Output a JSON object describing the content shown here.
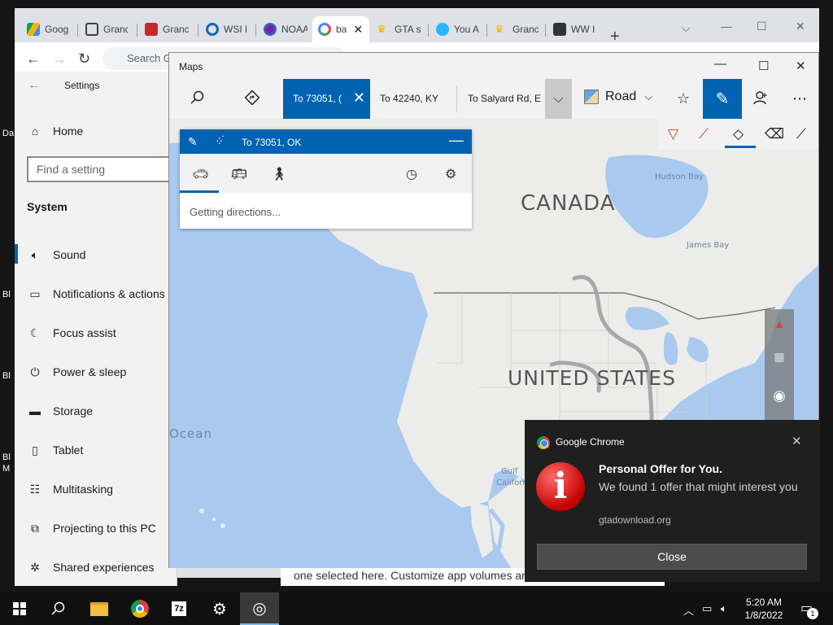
{
  "desktop": {
    "fragments": [
      "Da",
      "Bl",
      "Bl",
      "Bl",
      "M"
    ]
  },
  "chrome": {
    "tabs": [
      {
        "label": "Goog",
        "icon": "google-drive-icon"
      },
      {
        "label": "Granc",
        "icon": "page-icon"
      },
      {
        "label": "Granc",
        "icon": "rockstar-icon"
      },
      {
        "label": "WSI L",
        "icon": "wsi-icon"
      },
      {
        "label": "NOAA",
        "icon": "noaa-icon"
      },
      {
        "label": "ba",
        "icon": "google-icon",
        "active": true
      },
      {
        "label": "GTA s",
        "icon": "crown-icon"
      },
      {
        "label": "You A",
        "icon": "you-icon"
      },
      {
        "label": "Granc",
        "icon": "crown-icon"
      },
      {
        "label": "WW I",
        "icon": "ww-icon"
      }
    ],
    "omnibox_placeholder": "Search G"
  },
  "settings": {
    "title": "Settings",
    "home": "Home",
    "search_placeholder": "Find a setting",
    "section": "System",
    "items": [
      {
        "label": "Sound",
        "icon": "speaker-icon"
      },
      {
        "label": "Notifications & actions",
        "icon": "notification-icon"
      },
      {
        "label": "Focus assist",
        "icon": "moon-icon"
      },
      {
        "label": "Power & sleep",
        "icon": "power-icon"
      },
      {
        "label": "Storage",
        "icon": "storage-icon"
      },
      {
        "label": "Tablet",
        "icon": "tablet-icon"
      },
      {
        "label": "Multitasking",
        "icon": "multitasking-icon"
      },
      {
        "label": "Projecting to this PC",
        "icon": "projecting-icon"
      },
      {
        "label": "Shared experiences",
        "icon": "share-icon"
      }
    ],
    "sound_page_text": "one selected here. Customize app volumes an"
  },
  "maps": {
    "title": "Maps",
    "route_tabs": [
      "To 73051, (",
      "To 42240, KY",
      "To Salyard Rd, E"
    ],
    "map_style": "Road",
    "directions": {
      "title": "To 73051, OK",
      "status": "Getting directions..."
    },
    "labels": {
      "canada": "CANADA",
      "united_states": "UNITED STATES",
      "hudson_bay": "Hudson Bay",
      "james_bay": "James Bay",
      "ocean": "Ocean",
      "gulf": "Gulf",
      "californ": "Californ"
    }
  },
  "notification": {
    "app": "Google Chrome",
    "heading": "Personal Offer for You.",
    "body": "We found 1 offer that might interest you",
    "source": "gtadownload.org",
    "close": "Close"
  },
  "taskbar": {
    "time": "5:20 AM",
    "date": "1/8/2022",
    "notification_count": "1"
  },
  "colors": {
    "accent": "#0063b1",
    "map_water": "#a9c9ee",
    "map_land": "#ececea",
    "toast_bg": "#1f1f1f"
  }
}
